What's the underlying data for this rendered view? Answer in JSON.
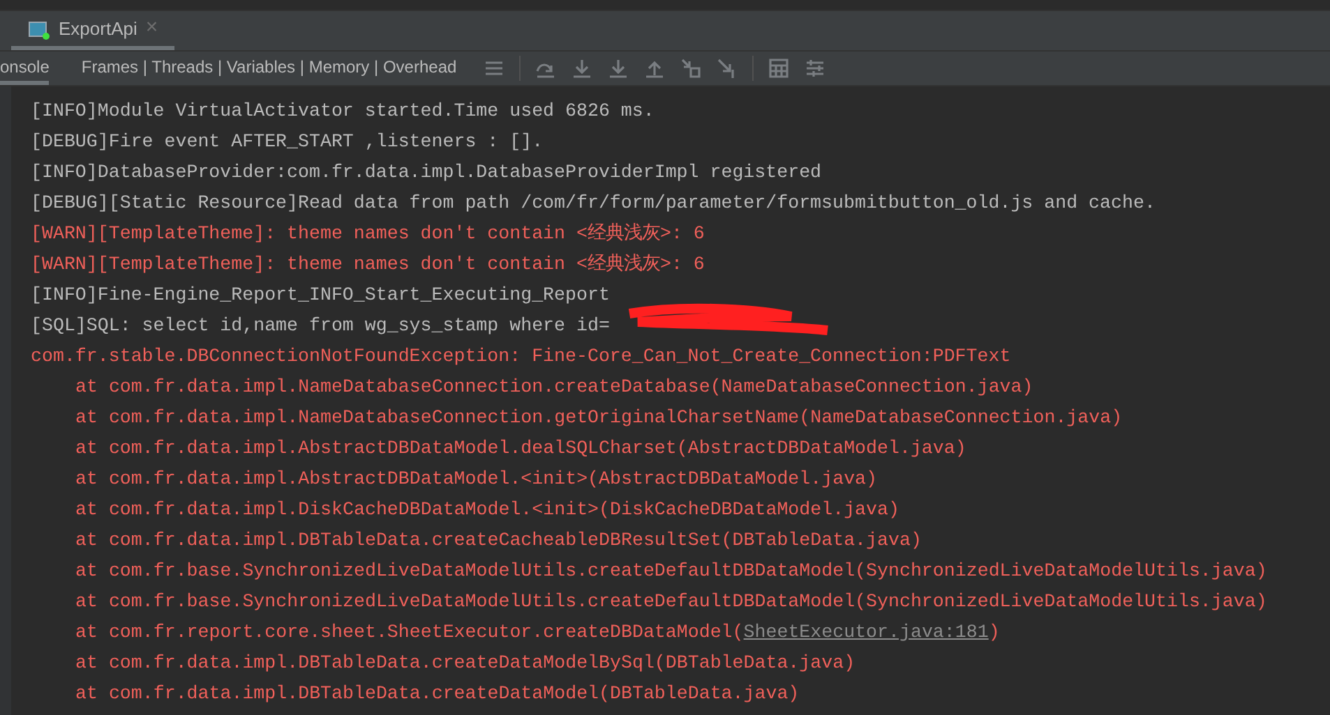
{
  "tab": {
    "title": "ExportApi",
    "close": "×",
    "selected": true
  },
  "toolbar": {
    "items": [
      {
        "label": "onsole",
        "selected": true
      },
      {
        "label": "Frames | Threads | Variables | Memory | Overhead",
        "selected": false
      }
    ]
  },
  "console": {
    "lines": [
      {
        "kind": "info",
        "parts": [
          {
            "kind": "plain",
            "text": "[INFO]Module VirtualActivator started.Time used 6826 ms."
          }
        ]
      },
      {
        "kind": "info",
        "parts": [
          {
            "kind": "plain",
            "text": "[DEBUG]Fire event AFTER_START ,listeners : []."
          }
        ]
      },
      {
        "kind": "info",
        "parts": [
          {
            "kind": "plain",
            "text": "[INFO]DatabaseProvider:com.fr.data.impl.DatabaseProviderImpl registered"
          }
        ]
      },
      {
        "kind": "info",
        "parts": [
          {
            "kind": "plain",
            "text": "[DEBUG][Static Resource]Read data from path /com/fr/form/parameter/formsubmitbutton_old.js and cache."
          }
        ]
      },
      {
        "kind": "error",
        "parts": [
          {
            "kind": "plain",
            "text": "[WARN][TemplateTheme]: theme names don't contain <经典浅灰>: 6"
          }
        ]
      },
      {
        "kind": "error",
        "parts": [
          {
            "kind": "plain",
            "text": "[WARN][TemplateTheme]: theme names don't contain <经典浅灰>: 6"
          }
        ]
      },
      {
        "kind": "info",
        "parts": [
          {
            "kind": "plain",
            "text": "[INFO]Fine-Engine_Report_INFO_Start_Executing_Report"
          }
        ]
      },
      {
        "kind": "info",
        "redacted": true,
        "parts": [
          {
            "kind": "plain",
            "text": "[SQL]SQL: select id,name from wg_sys_stamp where id="
          }
        ]
      },
      {
        "kind": "error",
        "parts": [
          {
            "kind": "plain",
            "text": "com.fr.stable.DBConnectionNotFoundException: Fine-Core_Can_Not_Create_Connection:PDFText"
          }
        ]
      },
      {
        "kind": "frame",
        "parts": [
          {
            "kind": "plain",
            "text": "at com.fr.data.impl.NameDatabaseConnection.createDatabase(NameDatabaseConnection.java)"
          }
        ]
      },
      {
        "kind": "frame",
        "parts": [
          {
            "kind": "plain",
            "text": "at com.fr.data.impl.NameDatabaseConnection.getOriginalCharsetName(NameDatabaseConnection.java)"
          }
        ]
      },
      {
        "kind": "frame",
        "parts": [
          {
            "kind": "plain",
            "text": "at com.fr.data.impl.AbstractDBDataModel.dealSQLCharset(AbstractDBDataModel.java)"
          }
        ]
      },
      {
        "kind": "frame",
        "parts": [
          {
            "kind": "plain",
            "text": "at com.fr.data.impl.AbstractDBDataModel.<init>(AbstractDBDataModel.java)"
          }
        ]
      },
      {
        "kind": "frame",
        "parts": [
          {
            "kind": "plain",
            "text": "at com.fr.data.impl.DiskCacheDBDataModel.<init>(DiskCacheDBDataModel.java)"
          }
        ]
      },
      {
        "kind": "frame",
        "parts": [
          {
            "kind": "plain",
            "text": "at com.fr.data.impl.DBTableData.createCacheableDBResultSet(DBTableData.java)"
          }
        ]
      },
      {
        "kind": "frame",
        "parts": [
          {
            "kind": "plain",
            "text": "at com.fr.base.SynchronizedLiveDataModelUtils.createDefaultDBDataModel(SynchronizedLiveDataModelUtils.java)"
          }
        ]
      },
      {
        "kind": "frame",
        "parts": [
          {
            "kind": "plain",
            "text": "at com.fr.base.SynchronizedLiveDataModelUtils.createDefaultDBDataModel(SynchronizedLiveDataModelUtils.java)"
          }
        ]
      },
      {
        "kind": "frame",
        "parts": [
          {
            "kind": "plain",
            "text": "at com.fr.report.core.sheet.SheetExecutor.createDBDataModel("
          },
          {
            "kind": "link",
            "text": "SheetExecutor.java:181"
          },
          {
            "kind": "plain",
            "text": ")"
          }
        ]
      },
      {
        "kind": "frame",
        "parts": [
          {
            "kind": "plain",
            "text": "at com.fr.data.impl.DBTableData.createDataModelBySql(DBTableData.java)"
          }
        ]
      },
      {
        "kind": "frame",
        "parts": [
          {
            "kind": "plain",
            "text": "at com.fr.data.impl.DBTableData.createDataModel(DBTableData.java)"
          }
        ]
      }
    ]
  }
}
